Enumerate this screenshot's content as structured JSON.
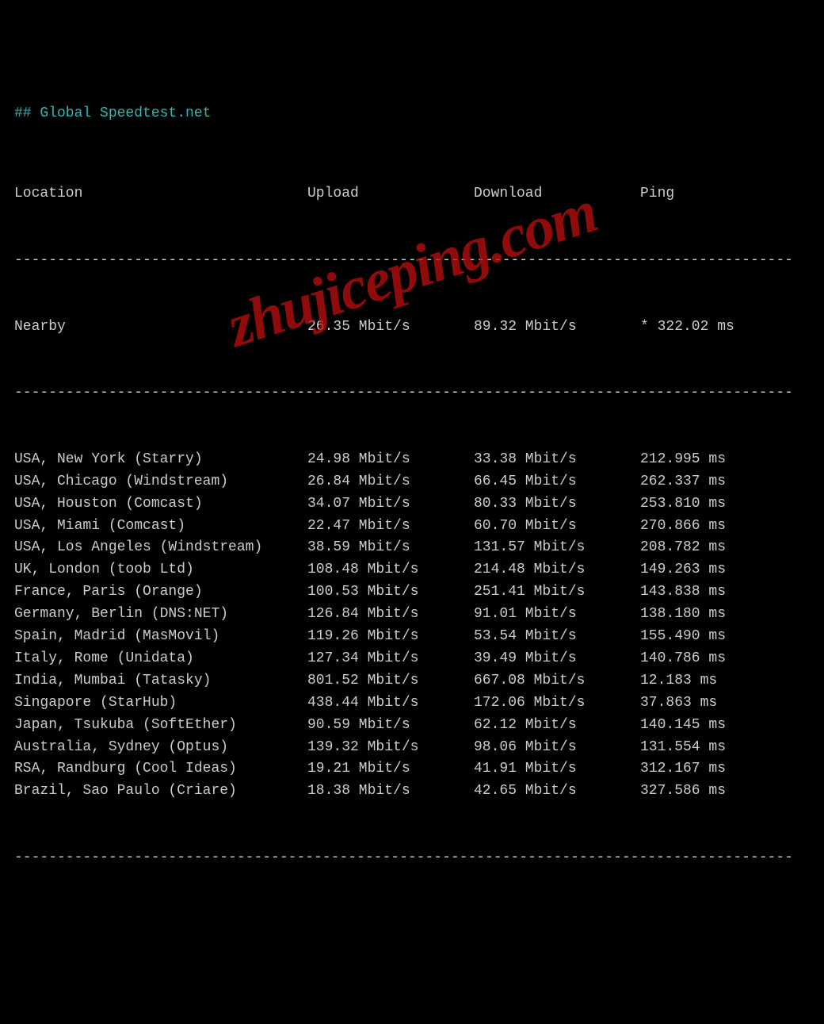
{
  "title": "## Global Speedtest.net",
  "dashes": "-------------------------------------------------------------------------------------------",
  "headers": {
    "location": "Location",
    "upload": "Upload",
    "download": "Download",
    "ping": "Ping"
  },
  "nearby": {
    "location": "Nearby",
    "upload": "26.35 Mbit/s",
    "download": "89.32 Mbit/s",
    "ping": "* 322.02 ms"
  },
  "rows": [
    {
      "location": "USA, New York (Starry)",
      "upload": "24.98 Mbit/s",
      "download": "33.38 Mbit/s",
      "ping": "212.995 ms"
    },
    {
      "location": "USA, Chicago (Windstream)",
      "upload": "26.84 Mbit/s",
      "download": "66.45 Mbit/s",
      "ping": "262.337 ms"
    },
    {
      "location": "USA, Houston (Comcast)",
      "upload": "34.07 Mbit/s",
      "download": "80.33 Mbit/s",
      "ping": "253.810 ms"
    },
    {
      "location": "USA, Miami (Comcast)",
      "upload": "22.47 Mbit/s",
      "download": "60.70 Mbit/s",
      "ping": "270.866 ms"
    },
    {
      "location": "USA, Los Angeles (Windstream)",
      "upload": "38.59 Mbit/s",
      "download": "131.57 Mbit/s",
      "ping": "208.782 ms"
    },
    {
      "location": "UK, London (toob Ltd)",
      "upload": "108.48 Mbit/s",
      "download": "214.48 Mbit/s",
      "ping": "149.263 ms"
    },
    {
      "location": "France, Paris (Orange)",
      "upload": "100.53 Mbit/s",
      "download": "251.41 Mbit/s",
      "ping": "143.838 ms"
    },
    {
      "location": "Germany, Berlin (DNS:NET)",
      "upload": "126.84 Mbit/s",
      "download": "91.01 Mbit/s",
      "ping": "138.180 ms"
    },
    {
      "location": "Spain, Madrid (MasMovil)",
      "upload": "119.26 Mbit/s",
      "download": "53.54 Mbit/s",
      "ping": "155.490 ms"
    },
    {
      "location": "Italy, Rome (Unidata)",
      "upload": "127.34 Mbit/s",
      "download": "39.49 Mbit/s",
      "ping": "140.786 ms"
    },
    {
      "location": "India, Mumbai (Tatasky)",
      "upload": "801.52 Mbit/s",
      "download": "667.08 Mbit/s",
      "ping": "12.183 ms"
    },
    {
      "location": "Singapore (StarHub)",
      "upload": "438.44 Mbit/s",
      "download": "172.06 Mbit/s",
      "ping": "37.863 ms"
    },
    {
      "location": "Japan, Tsukuba (SoftEther)",
      "upload": "90.59 Mbit/s",
      "download": "62.12 Mbit/s",
      "ping": "140.145 ms"
    },
    {
      "location": "Australia, Sydney (Optus)",
      "upload": "139.32 Mbit/s",
      "download": "98.06 Mbit/s",
      "ping": "131.554 ms"
    },
    {
      "location": "RSA, Randburg (Cool Ideas)",
      "upload": "19.21 Mbit/s",
      "download": "41.91 Mbit/s",
      "ping": "312.167 ms"
    },
    {
      "location": "Brazil, Sao Paulo (Criare)",
      "upload": "18.38 Mbit/s",
      "download": "42.65 Mbit/s",
      "ping": "327.586 ms"
    }
  ],
  "watermark": "zhujiceping.com"
}
